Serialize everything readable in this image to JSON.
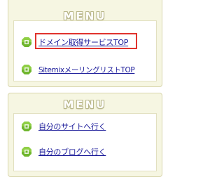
{
  "menu_boxes": [
    {
      "title": "MENU",
      "items": [
        {
          "label": "ドメイン取得サービスTOP",
          "icon": "green-bullet-icon",
          "highlighted": true
        },
        {
          "label": "SitemixメーリングリストTOP",
          "icon": "green-bullet-icon",
          "highlighted": false
        }
      ]
    },
    {
      "title": "MENU",
      "items": [
        {
          "label": "自分のサイトへ行く",
          "icon": "green-bullet-icon",
          "highlighted": false
        },
        {
          "label": "自分のブログへ行く",
          "icon": "green-bullet-icon",
          "highlighted": false
        }
      ]
    }
  ],
  "colors": {
    "link": "#1a1a99",
    "box_background": "#f6f6e2",
    "box_border": "#d8d6ac",
    "bullet": "#6fb62e",
    "highlight_border": "#e0332d"
  }
}
